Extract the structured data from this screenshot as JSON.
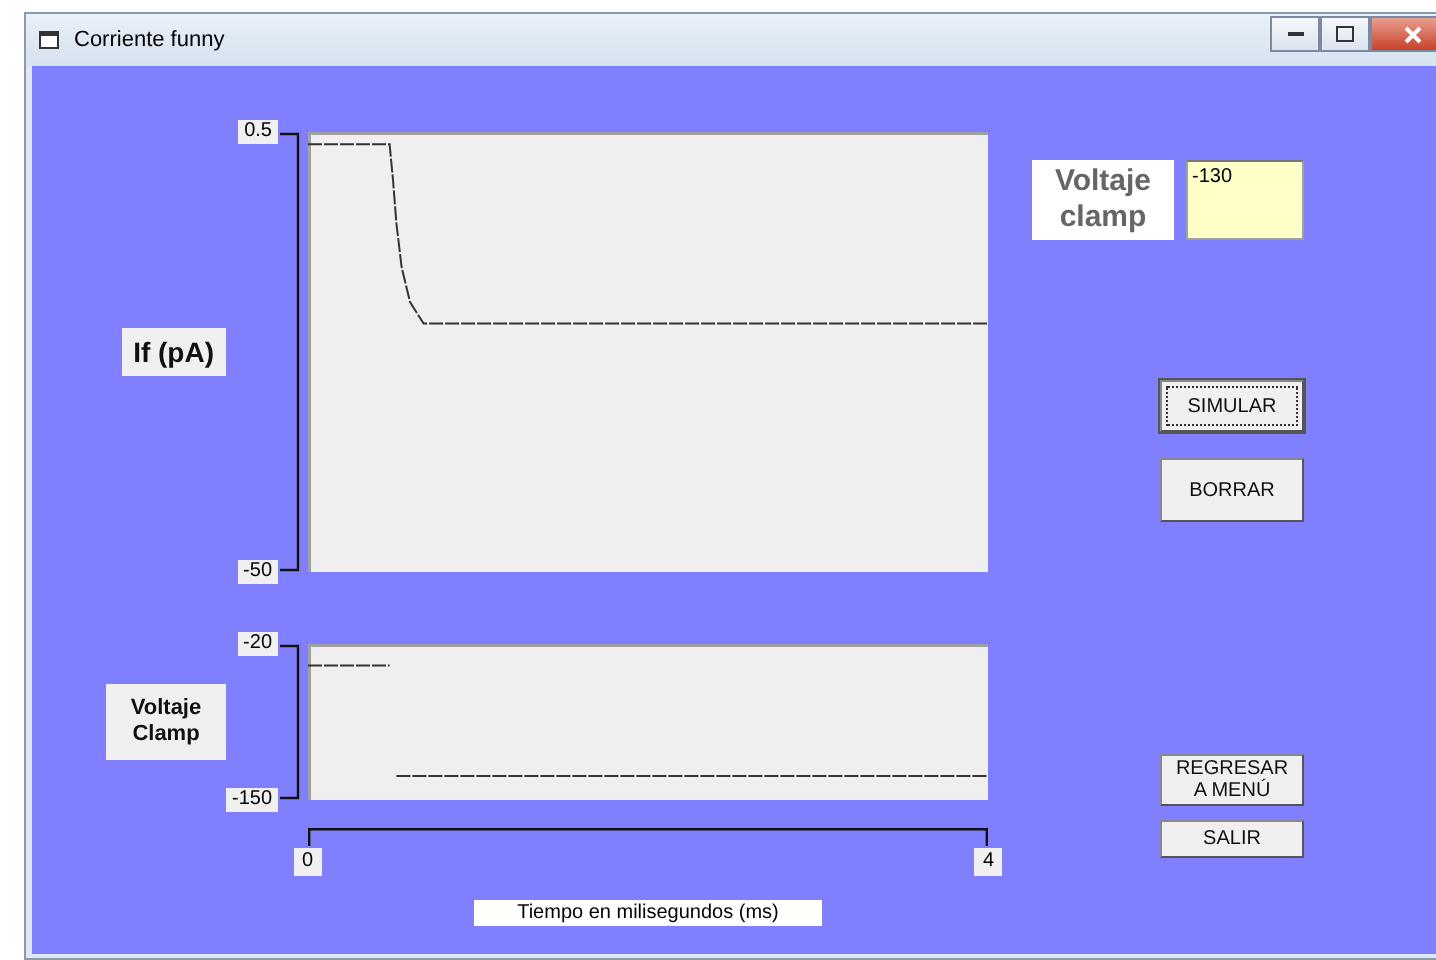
{
  "window": {
    "title": "Corriente funny"
  },
  "current_chart": {
    "chart_data": {
      "type": "line",
      "ylabel": "If (pA)",
      "xlim": [
        0,
        4
      ],
      "ylim": [
        -50,
        0.5
      ],
      "yticks": [
        0.5,
        -50
      ],
      "series": [
        {
          "color": "#333333",
          "line_style": "dashed",
          "x": [
            0,
            0.25,
            0.48,
            0.5,
            0.52,
            0.55,
            0.6,
            0.68,
            1,
            2,
            3,
            4
          ],
          "values": [
            -0.9,
            -0.9,
            -0.9,
            -5,
            -10,
            -15,
            -19,
            -21.5,
            -21.5,
            -21.5,
            -21.5,
            -21.5
          ]
        }
      ]
    }
  },
  "voltage_chart": {
    "chart_data": {
      "type": "line",
      "ylabel": "Voltaje Clamp",
      "xlabel": "Tiempo en milisegundos (ms)",
      "xlim": [
        0,
        4
      ],
      "ylim": [
        -150,
        -20
      ],
      "yticks": [
        -20,
        -150
      ],
      "xticks": [
        0,
        4
      ],
      "series": [
        {
          "color": "#333333",
          "line_style": "dashed",
          "x": [
            0,
            0.48,
            0.49,
            0.52,
            4
          ],
          "values": [
            -38,
            -38,
            null,
            -130,
            -130
          ]
        }
      ]
    }
  },
  "clamp_field": {
    "label": "Voltaje clamp",
    "value": "-130"
  },
  "buttons": [
    {
      "label": "SIMULAR",
      "focused": true
    },
    {
      "label": "BORRAR",
      "focused": false
    },
    {
      "label": "REGRESAR A MENÚ",
      "focused": false
    },
    {
      "label": "SALIR",
      "focused": false
    }
  ]
}
